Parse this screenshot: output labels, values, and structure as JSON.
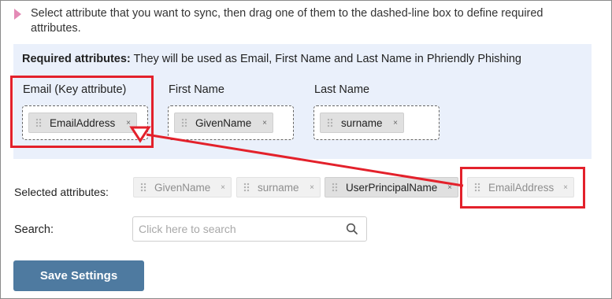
{
  "instructions": "Select attribute that you want to sync, then drag one of them to the dashed-line box to define required attributes.",
  "required_panel": {
    "heading": "Required attributes:",
    "description": "They will be used as Email, First Name and Last Name in Phriendly Phishing",
    "fields": [
      {
        "label": "Email (Key attribute)",
        "chip": "EmailAddress"
      },
      {
        "label": "First Name",
        "chip": "GivenName"
      },
      {
        "label": "Last Name",
        "chip": "surname"
      }
    ]
  },
  "selected": {
    "label": "Selected attributes:",
    "chips": [
      "GivenName",
      "surname",
      "UserPrincipalName",
      "EmailAddress"
    ]
  },
  "search": {
    "label": "Search:",
    "placeholder": "Click here to search",
    "icon": "search-icon"
  },
  "save_label": "Save Settings",
  "remove_glyph": "×",
  "colors": {
    "panel_bg": "#eaf0fb",
    "save_button": "#4e7aa0",
    "annotation": "#e3212b",
    "instruction_marker": "#e48ab6"
  }
}
